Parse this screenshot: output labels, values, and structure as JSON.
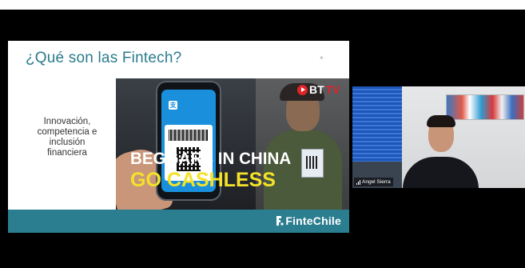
{
  "slide": {
    "title": "¿Qué son las Fintech?",
    "bullet_lines": [
      "Innovación,",
      "competencia e",
      "inclusión",
      "financiera"
    ],
    "photo": {
      "headline_line1": "BEGGARS IN CHINA",
      "headline_line2": "GO CASHLESS",
      "channel_bt": "BT",
      "channel_tv": "TV"
    },
    "footer_logo": "FinteChile"
  },
  "participant": {
    "name": "Angel Sierra"
  },
  "colors": {
    "meeting_background": "#000000",
    "slide_title": "#2a7c8c",
    "slide_footer": "#2b7d90",
    "headline_yellow": "#f4e22a",
    "bttv_red": "#e0242a"
  },
  "icons": [
    "play-circle-icon",
    "finte-logo-icon",
    "signal-bars-icon"
  ]
}
